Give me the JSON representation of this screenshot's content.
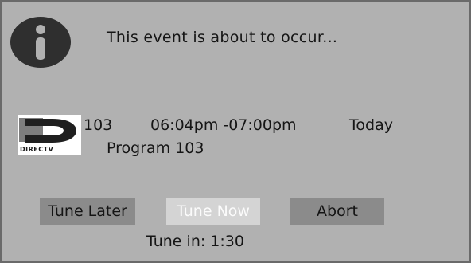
{
  "dialog": {
    "message": "This event is about to occur...",
    "icon": "info-icon"
  },
  "event": {
    "logo_text": "DIRECTV",
    "channel": "103",
    "time_range": "06:04pm -07:00pm",
    "day": "Today",
    "program": "Program 103"
  },
  "buttons": {
    "tune_later": "Tune Later",
    "tune_now": "Tune Now",
    "abort": "Abort",
    "selected": "tune_now"
  },
  "countdown": {
    "text": "Tune in:  1:30"
  },
  "colors": {
    "dialog_bg": "#b1b1b1",
    "button_bg": "#8b8b8b",
    "button_selected_bg": "#d4d4d4",
    "text": "#151515"
  }
}
